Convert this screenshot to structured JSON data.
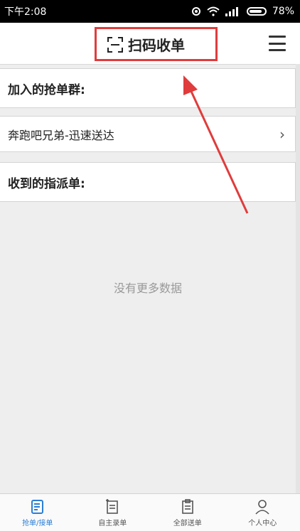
{
  "status_bar": {
    "time": "下午2:08",
    "battery": "78%"
  },
  "header": {
    "title": "扫码收单",
    "scan_icon": "scan-frame-icon",
    "menu_icon": "hamburger-menu-icon"
  },
  "sections": {
    "joined_groups_title": "加入的抢单群:",
    "group_item": "奔跑吧兄弟-迅速送达",
    "assigned_title": "收到的指派单:"
  },
  "empty_message": "没有更多数据",
  "tabs": [
    {
      "label": "抢单/接单",
      "icon": "order-grab-icon",
      "active": true
    },
    {
      "label": "自主录单",
      "icon": "order-entry-icon",
      "active": false
    },
    {
      "label": "全部送单",
      "icon": "clipboard-icon",
      "active": false
    },
    {
      "label": "个人中心",
      "icon": "person-icon",
      "active": false
    }
  ],
  "colors": {
    "highlight": "#e03c3c",
    "accent": "#2b7fd6"
  }
}
